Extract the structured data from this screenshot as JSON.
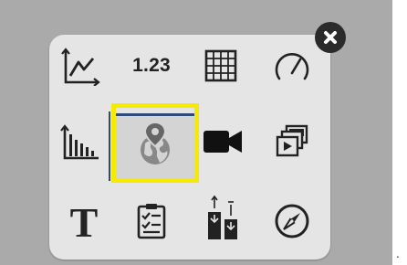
{
  "colors": {
    "backdrop": "#aaaaaa",
    "panel": "#e5e5e5",
    "icon": "#222222",
    "highlight_border": "#f6ea00",
    "selected_tile_bg": "#d4d4d4",
    "selected_accent": "#2e4a78",
    "close_bg": "#2b2b2b"
  },
  "dialog": {
    "close_icon": "close-x-icon",
    "tiles": [
      {
        "icon": "line-chart-icon"
      },
      {
        "icon": "number-icon",
        "label": "1.23"
      },
      {
        "icon": "table-grid-icon"
      },
      {
        "icon": "gauge-icon"
      },
      {
        "icon": "bar-chart-icon"
      },
      {
        "icon": "globe-map-pin-icon",
        "selected": true
      },
      {
        "icon": "video-camera-icon"
      },
      {
        "icon": "media-gallery-icon"
      },
      {
        "icon": "text-icon",
        "label": "T"
      },
      {
        "icon": "checklist-icon"
      },
      {
        "icon": "stacked-bars-icon"
      },
      {
        "icon": "compass-icon"
      }
    ]
  },
  "trailing_text": "."
}
